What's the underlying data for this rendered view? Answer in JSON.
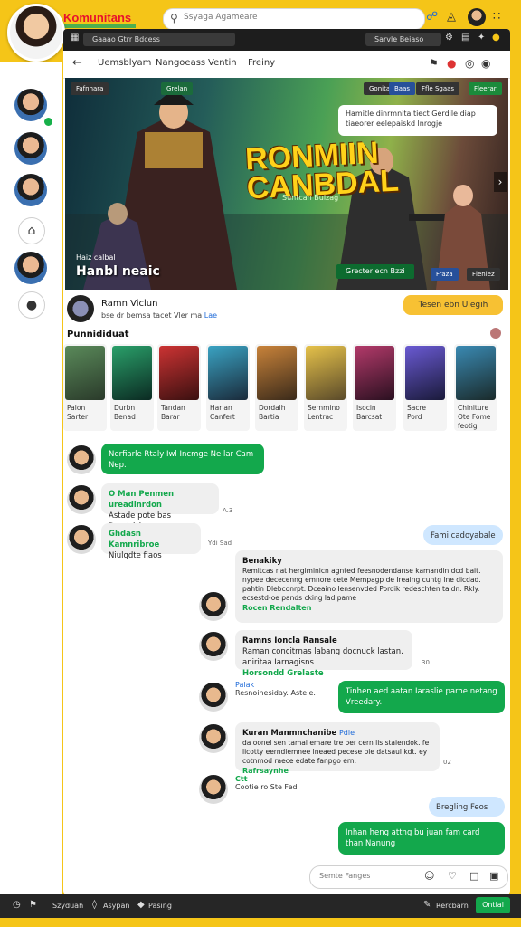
{
  "app": {
    "brand": "Komunitans"
  },
  "top_search": {
    "placeholder": "Ssyaga Agameare"
  },
  "window": {
    "address": "Gaaao Gtrr Bdcess",
    "address_right": "Sarvle Beiaso",
    "nav": {
      "tabs": [
        "Uemsblyam",
        "Nangoeass",
        "Ventin",
        "Freiny"
      ]
    }
  },
  "hero": {
    "chips": [
      "Fafnnara",
      "Grelan",
      "Gonitaa",
      "Baas",
      "Ffle Sgaas",
      "Fleerar"
    ],
    "title_line1": "RONMIIN",
    "title_line2": "CANBDAL",
    "subtitle": "Suntcan Bulzag",
    "callout": "Hamitle dinrmnita tiect Gerdile diap tiaeorer eelepaiskd lnrogje",
    "bottom_small": "Haiz calbal",
    "bottom_title": "Hanbl neaic",
    "bar_left": "Grecter ecn Bzzi",
    "bar_mid": "Fraza",
    "bar_right": "Fleniez"
  },
  "room": {
    "name": "Ramn Viclun",
    "meta_prefix": "bse dr bemsa tacet Vler ma",
    "meta_link": "Lae",
    "join_label": "Tesen ebn Ulegih"
  },
  "section": {
    "title": "Punnididuat"
  },
  "cards": [
    {
      "l1": "Palon",
      "l2": "Sarter",
      "l3": ""
    },
    {
      "l1": "Durbn",
      "l2": "Benad",
      "l3": ""
    },
    {
      "l1": "Tandan",
      "l2": "Barar",
      "l3": ""
    },
    {
      "l1": "Harlan",
      "l2": "Canfert",
      "l3": ""
    },
    {
      "l1": "Dordalh",
      "l2": "Bartia",
      "l3": ""
    },
    {
      "l1": "Sernmino",
      "l2": "Lentrac",
      "l3": ""
    },
    {
      "l1": "Isocin",
      "l2": "Barcsat",
      "l3": ""
    },
    {
      "l1": "Sacre",
      "l2": "Pord",
      "l3": ""
    },
    {
      "l1": "Chiniture",
      "l2": "Ote Fome",
      "l3": "feotig"
    }
  ],
  "messages": [
    {
      "text": "Nerfiarle Rtaly Iwl Incmge Ne lar Cam Nep."
    },
    {
      "name": "O Man Penmen ureadinrdon",
      "text": "Astade pote bas Dendsishen",
      "time": "A.3"
    },
    {
      "name": "Ghdasn Kamnribroe",
      "text": "Niulgdte fiaos",
      "time": "Ydi Sad"
    },
    {
      "reaction": "Fami cadoyabale"
    },
    {
      "name": "Benakiky",
      "text": "Remitcas nat hergiminicn agnted feesnodendanse kamandin dcd bait. nypee dececenng emnore cete Mempagp de Ireaing cuntg lne dicdad. pahtin Dlebconrpt. Dceaino Iensenvded Pordik redeschten taldn. Rkly. ecsestd-oe pands cking lad pame",
      "link": "Rocen Rendalten"
    },
    {
      "name": "Ramns Ioncla Ransale",
      "text": "Raman concitrnas labang docnuck lastan. aniritaa Iarnagisns",
      "link": "Horsondd Grelaste",
      "time": "30"
    },
    {
      "name": "Palak",
      "text": "Resnoinesiday. Astele."
    },
    {
      "text": "Tinhen aed aatan Iaraslie parhe netang Vreedary."
    },
    {
      "name": "Kuran Manmnchanibe",
      "tag": "Pdle",
      "text": "da oonel sen tamal emare tre oer cern lis staiendok. fe licotty eerndiemnee lneaed pecese bie datsaul kdt. ey cotnmod raece edate fanpgo ern.",
      "link": "Rafrsaynhe",
      "time": "02"
    },
    {
      "name": "Ctt",
      "text": "Cootie ro Ste Fed"
    },
    {
      "reaction": "Bregling Feos"
    },
    {
      "text": "Inhan heng attng bu juan fam card than Nanung"
    }
  ],
  "composer": {
    "placeholder": "Semte Fanges"
  },
  "bottom": {
    "items": [
      "Szyduah",
      "Asypan",
      "Pasing"
    ],
    "right_label": "Rercbarn",
    "send_label": "Ontial"
  },
  "colors": {
    "accent": "#13a84c",
    "frame": "#f5c518",
    "brand": "#e8112d"
  }
}
